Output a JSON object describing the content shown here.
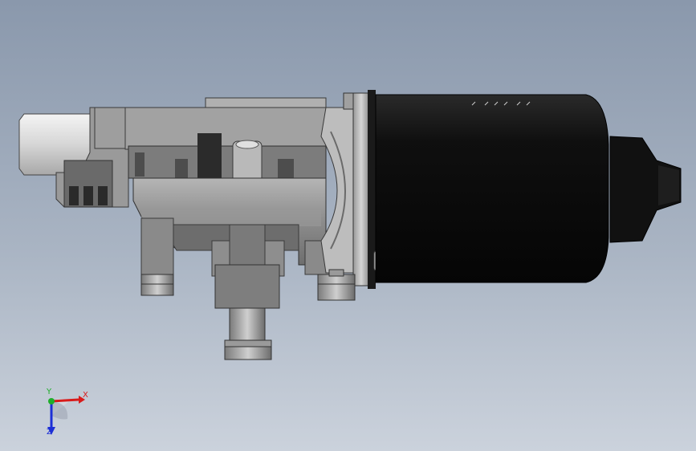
{
  "viewport": {
    "background_top": "#8a98ac",
    "background_bottom": "#cbd2dc"
  },
  "model": {
    "motor_color": "#0d0d0d",
    "housing_color": "#8f8f8f",
    "connector_color": "#d9d9d9"
  },
  "triad": {
    "x_label": "X",
    "y_label": "Y",
    "z_label": "Z",
    "x_color": "#d81b1b",
    "y_color": "#1fae2a",
    "z_color": "#1c2fd6"
  }
}
